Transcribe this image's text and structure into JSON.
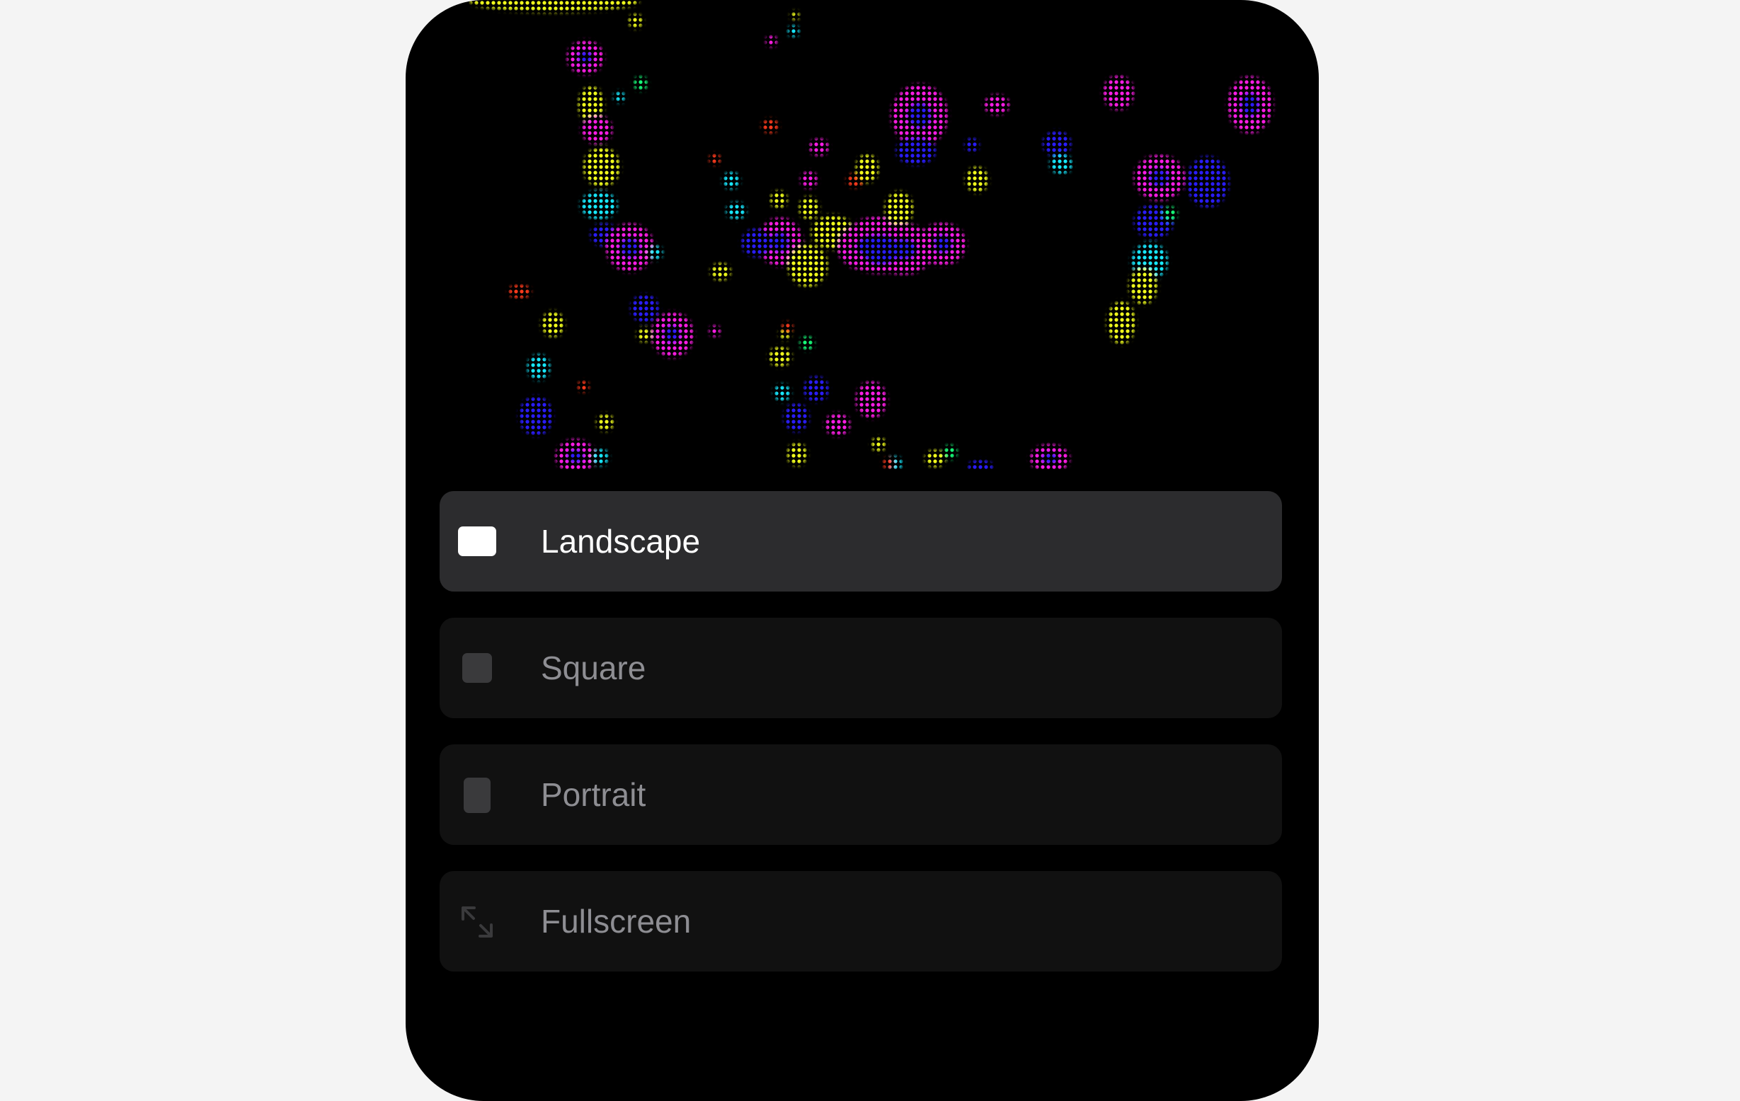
{
  "preview": {
    "description_icon": "generative-art-preview"
  },
  "options": [
    {
      "id": "landscape",
      "label": "Landscape",
      "icon": "landscape-icon",
      "selected": true
    },
    {
      "id": "square",
      "label": "Square",
      "icon": "square-icon",
      "selected": false
    },
    {
      "id": "portrait",
      "label": "Portrait",
      "icon": "portrait-icon",
      "selected": false
    },
    {
      "id": "fullscreen",
      "label": "Fullscreen",
      "icon": "fullscreen-icon",
      "selected": false
    }
  ],
  "colors": {
    "page_background": "#f4f4f4",
    "device_background": "#000000",
    "selected_row": "#2c2c2e",
    "unselected_row": "#111111",
    "selected_text": "#ffffff",
    "unselected_text": "#8e8e93",
    "selected_icon": "#ffffff",
    "unselected_icon": "#3a3a3c",
    "art_magenta": "#ff1ee6",
    "art_yellow": "#f2ff1a",
    "art_blue": "#2a1aff",
    "art_cyan": "#19e8ff",
    "art_green": "#19ff7a",
    "art_red": "#ff3a1a"
  }
}
